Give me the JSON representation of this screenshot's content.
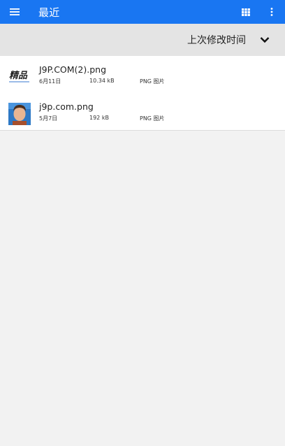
{
  "app_bar": {
    "title": "最近",
    "menu_icon": "menu-icon",
    "grid_icon": "grid-view-icon",
    "more_icon": "more-vert-icon",
    "color": "#1976f2"
  },
  "sort_bar": {
    "label": "上次修改时间",
    "chevron_icon": "chevron-down-icon"
  },
  "files": [
    {
      "name": "J9P.COM(2).png",
      "date": "6月11日",
      "size": "10.34 kB",
      "type": "PNG 图片",
      "thumb_text": "精品"
    },
    {
      "name": "j9p.com.png",
      "date": "5月7日",
      "size": "192 kB",
      "type": "PNG 图片"
    }
  ]
}
